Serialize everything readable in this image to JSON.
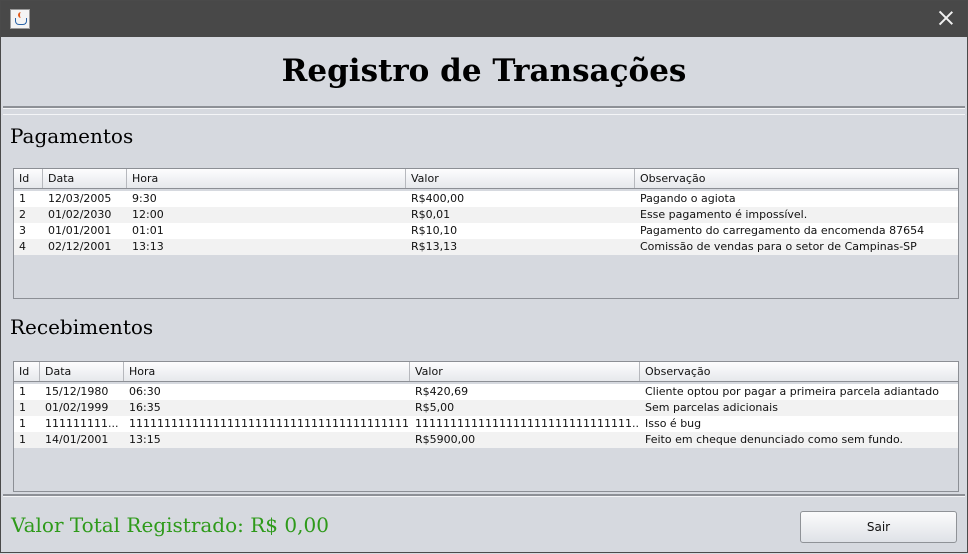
{
  "window": {
    "title": ""
  },
  "header": {
    "title": "Registro de Transações"
  },
  "pagamentos": {
    "label": "Pagamentos",
    "columns": [
      "Id",
      "Data",
      "Hora",
      "Valor",
      "Observação"
    ],
    "rows": [
      [
        "1",
        "12/03/2005",
        "9:30",
        "R$400,00",
        "Pagando o agiota"
      ],
      [
        "2",
        "01/02/2030",
        "12:00",
        "R$0,01",
        "Esse pagamento é impossível."
      ],
      [
        "3",
        "01/01/2001",
        "01:01",
        "R$10,10",
        "Pagamento do carregamento da encomenda 87654"
      ],
      [
        "4",
        "02/12/2001",
        "13:13",
        "R$13,13",
        "Comissão de vendas para o setor de Campinas-SP"
      ]
    ]
  },
  "recebimentos": {
    "label": "Recebimentos",
    "columns": [
      "Id",
      "Data",
      "Hora",
      "Valor",
      "Observação"
    ],
    "rows": [
      [
        "1",
        "15/12/1980",
        "06:30",
        "R$420,69",
        "Cliente optou por pagar a primeira parcela adiantado"
      ],
      [
        "1",
        "01/02/1999",
        "16:35",
        "R$5,00",
        "Sem parcelas adicionais"
      ],
      [
        "1",
        "111111111...",
        "1111111111111111111111111111111111111111...",
        "1111111111111111111111111111111...",
        "Isso é bug"
      ],
      [
        "1",
        "14/01/2001",
        "13:15",
        "R$5900,00",
        "Feito em cheque denunciado como sem fundo."
      ]
    ]
  },
  "footer": {
    "total_label": "Valor Total Registrado: R$ 0,00",
    "exit_button": "Sair"
  },
  "colors": {
    "total_text": "#2e9a1a",
    "titlebar": "#484848"
  },
  "icons": {
    "app": "java-icon",
    "close": "close-icon"
  }
}
